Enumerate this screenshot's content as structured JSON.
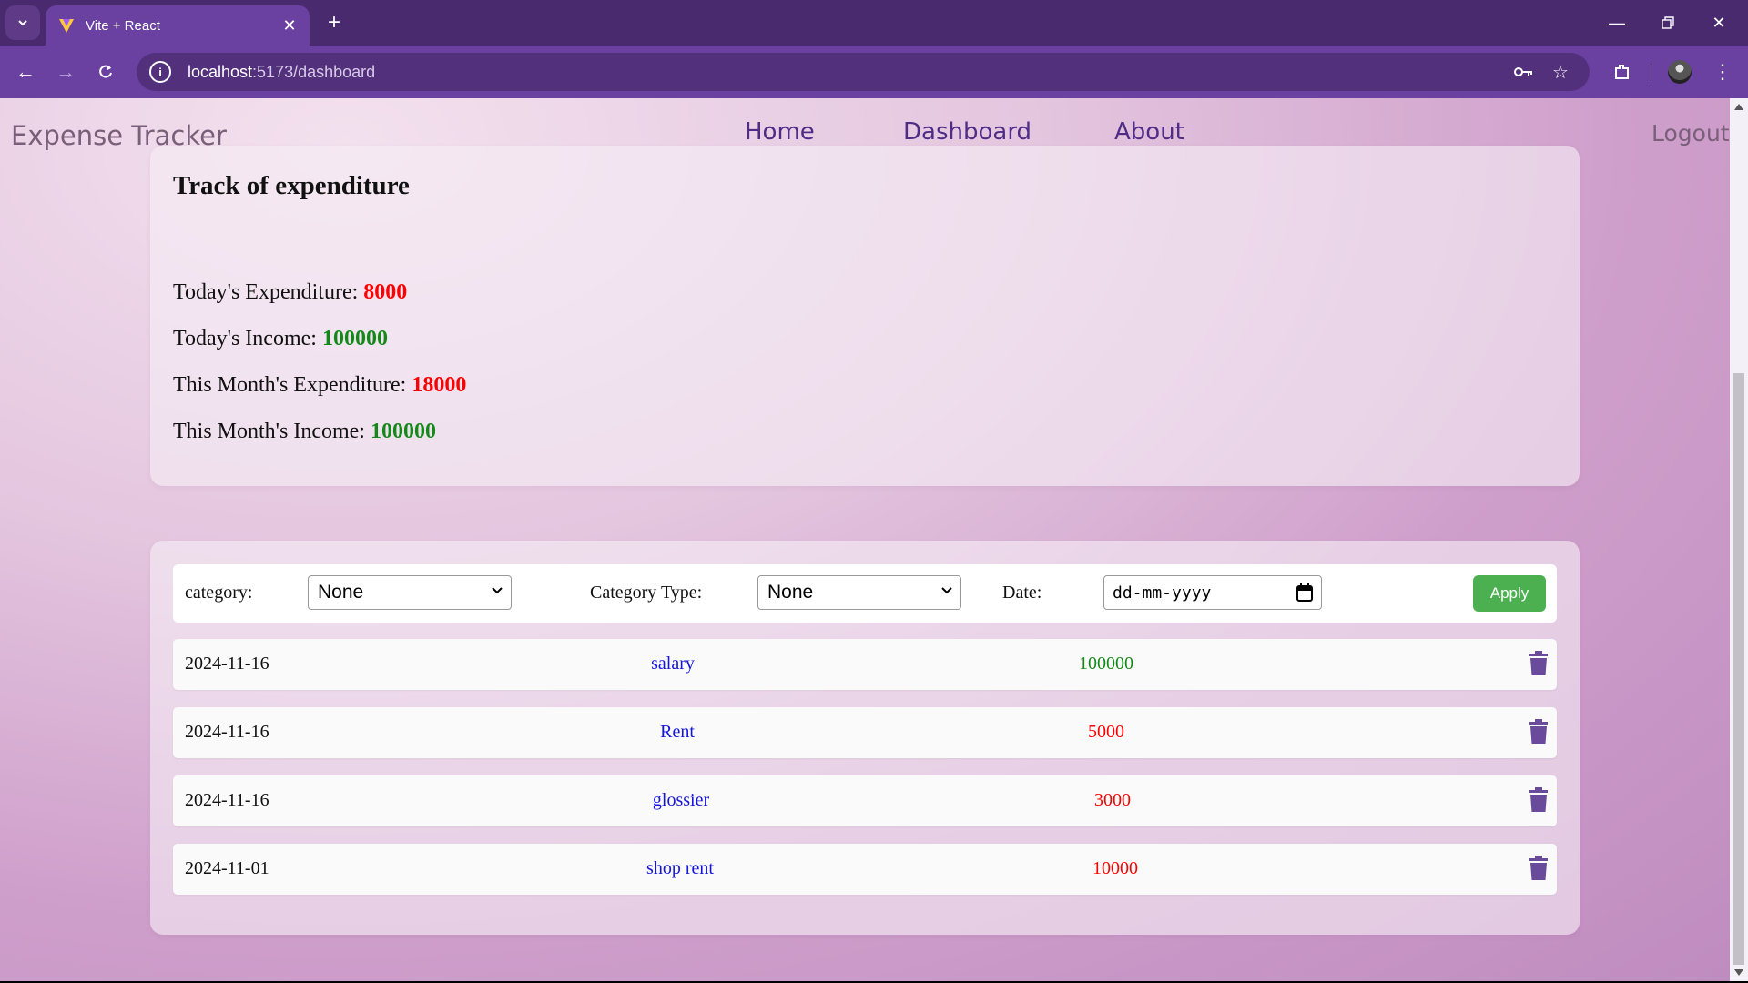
{
  "browser": {
    "tab_title": "Vite + React",
    "url_host": "localhost",
    "url_path": ":5173/dashboard"
  },
  "header": {
    "brand": "Expense Tracker",
    "nav": [
      "Home",
      "Dashboard",
      "About"
    ],
    "logout": "Logout"
  },
  "summary": {
    "title": "Track of expenditure",
    "stats": [
      {
        "label": "Today's Expenditure: ",
        "value": "8000",
        "kind": "expense"
      },
      {
        "label": "Today's Income: ",
        "value": "100000",
        "kind": "income"
      },
      {
        "label": "This Month's Expenditure: ",
        "value": "18000",
        "kind": "expense"
      },
      {
        "label": "This Month's Income: ",
        "value": "100000",
        "kind": "income"
      }
    ]
  },
  "filters": {
    "category_label": "category:",
    "category_value": "None",
    "category_type_label": "Category Type:",
    "category_type_value": "None",
    "date_label": "Date:",
    "date_placeholder": "dd-mm-yyyy",
    "apply_label": "Apply"
  },
  "transactions": [
    {
      "date": "2024-11-16",
      "category": "salary",
      "amount": "100000",
      "kind": "income"
    },
    {
      "date": "2024-11-16",
      "category": "Rent",
      "amount": "5000",
      "kind": "expense"
    },
    {
      "date": "2024-11-16",
      "category": "glossier",
      "amount": "3000",
      "kind": "expense"
    },
    {
      "date": "2024-11-01",
      "category": "shop rent",
      "amount": "10000",
      "kind": "expense"
    }
  ],
  "colors": {
    "expense": "#ff0000",
    "income": "#15881a",
    "category": "#1515e0",
    "apply": "#4caf50",
    "trash": "#6a4a9a"
  }
}
